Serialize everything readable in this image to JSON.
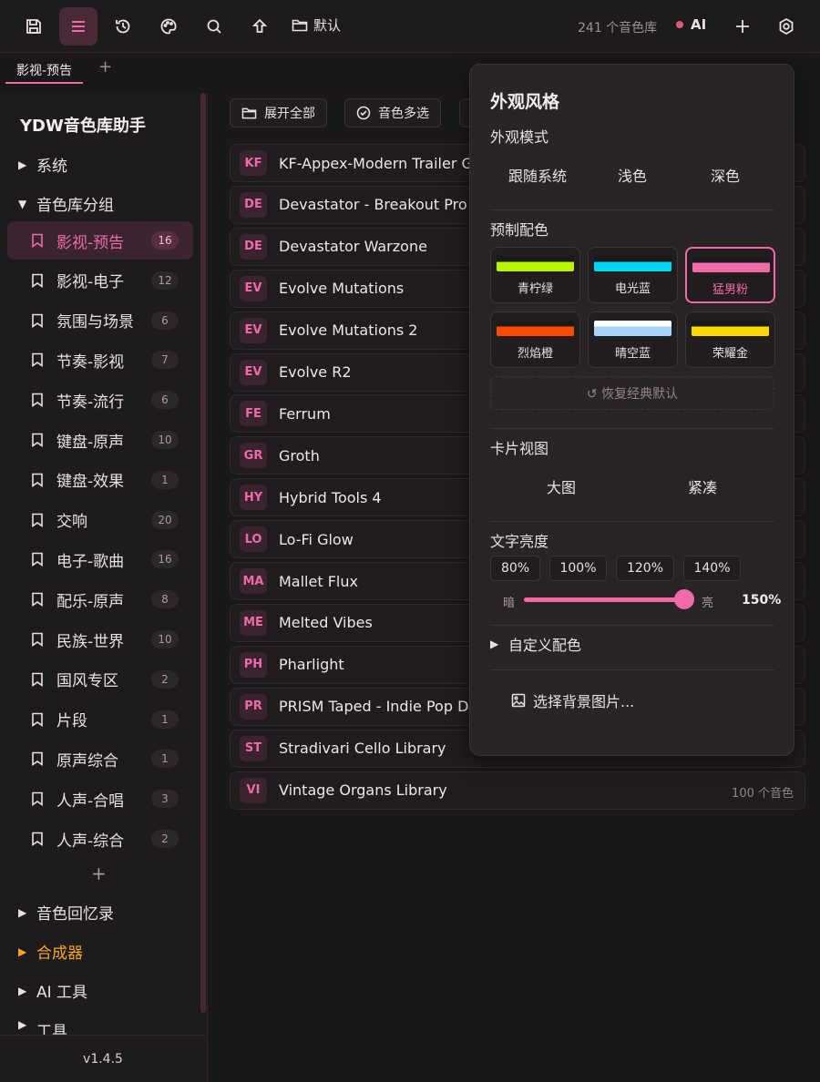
{
  "toolbar": {
    "folder_label": "默认",
    "library_count": "241 个音色库",
    "ai_label": "AI"
  },
  "tabs": {
    "active_tab": "影视-预告",
    "add_label": "+"
  },
  "sidebar": {
    "title": "YDW音色库助手",
    "sections": {
      "system": "系统",
      "groups": "音色库分组",
      "memory": "音色回忆录",
      "synth": "合成器",
      "ai_tools": "AI 工具",
      "tools": "工具"
    },
    "groups": [
      {
        "label": "影视-预告",
        "count": "16"
      },
      {
        "label": "影视-电子",
        "count": "12"
      },
      {
        "label": "氛围与场景",
        "count": "6"
      },
      {
        "label": "节奏-影视",
        "count": "7"
      },
      {
        "label": "节奏-流行",
        "count": "6"
      },
      {
        "label": "键盘-原声",
        "count": "10"
      },
      {
        "label": "键盘-效果",
        "count": "1"
      },
      {
        "label": "交响",
        "count": "20"
      },
      {
        "label": "电子-歌曲",
        "count": "16"
      },
      {
        "label": "配乐-原声",
        "count": "8"
      },
      {
        "label": "民族-世界",
        "count": "10"
      },
      {
        "label": "国风专区",
        "count": "2"
      },
      {
        "label": "片段",
        "count": "1"
      },
      {
        "label": "原声综合",
        "count": "1"
      },
      {
        "label": "人声-合唱",
        "count": "3"
      },
      {
        "label": "人声-综合",
        "count": "2"
      }
    ],
    "add_group": "+",
    "version": "v1.4.5"
  },
  "main": {
    "expand_all": "展开全部",
    "multi_select": "音色多选",
    "libraries": [
      {
        "badge": "KF",
        "name": "KF-Appex-Modern Trailer Gu",
        "count": ""
      },
      {
        "badge": "DE",
        "name": "Devastator - Breakout Pro",
        "count": ""
      },
      {
        "badge": "DE",
        "name": "Devastator Warzone",
        "count": ""
      },
      {
        "badge": "EV",
        "name": "Evolve Mutations",
        "count": ""
      },
      {
        "badge": "EV",
        "name": "Evolve Mutations 2",
        "count": ""
      },
      {
        "badge": "EV",
        "name": "Evolve R2",
        "count": ""
      },
      {
        "badge": "FE",
        "name": "Ferrum",
        "count": ""
      },
      {
        "badge": "GR",
        "name": "Groth",
        "count": ""
      },
      {
        "badge": "HY",
        "name": "Hybrid Tools 4",
        "count": ""
      },
      {
        "badge": "LO",
        "name": "Lo-Fi Glow",
        "count": ""
      },
      {
        "badge": "MA",
        "name": "Mallet Flux",
        "count": ""
      },
      {
        "badge": "ME",
        "name": "Melted Vibes",
        "count": ""
      },
      {
        "badge": "PH",
        "name": "Pharlight",
        "count": ""
      },
      {
        "badge": "PR",
        "name": "PRISM Taped - Indie Pop Dru",
        "count": ""
      },
      {
        "badge": "ST",
        "name": "Stradivari Cello Library",
        "count": ""
      },
      {
        "badge": "VI",
        "name": "Vintage Organs Library",
        "count": "100 个音色"
      }
    ]
  },
  "panel": {
    "title": "外观风格",
    "mode_label": "外观模式",
    "modes": [
      "跟随系统",
      "浅色",
      "深色"
    ],
    "preset_label": "预制配色",
    "presets": [
      {
        "name": "青柠绿",
        "color": "#b8f400",
        "top": "#1a1a1a"
      },
      {
        "name": "电光蓝",
        "color": "#00d4f0",
        "top": "#1a1a1a"
      },
      {
        "name": "猛男粉",
        "color": "#f06aa8",
        "top": "#1a1a1a"
      },
      {
        "name": "烈焰橙",
        "color": "#ff4a00",
        "top": "#1a1a1a"
      },
      {
        "name": "晴空蓝",
        "color": "#a8d4f8",
        "top": "#ffffff"
      },
      {
        "name": "荣耀金",
        "color": "#ffd700",
        "top": "#1a1a1a"
      }
    ],
    "selected_preset": "猛男粉",
    "restore_label": "↺ 恢复经典默认",
    "card_view_label": "卡片视图",
    "card_views": [
      "大图",
      "紧凑"
    ],
    "brightness_label": "文字亮度",
    "brightness_options": [
      "80%",
      "100%",
      "120%",
      "140%"
    ],
    "slider_dark": "暗",
    "slider_bright": "亮",
    "brightness_value": "150%",
    "brightness_level": 1.0,
    "custom_label": "自定义配色",
    "bg_label": "选择背景图片..."
  },
  "colors": {
    "accent": "#f06aa8",
    "background": "#1b1819",
    "panel": "#2a2426"
  },
  "icons": [
    "save-icon",
    "menu-icon",
    "history-icon",
    "palette-icon",
    "search-icon",
    "upload-icon",
    "folder-icon",
    "plus-icon",
    "settings-icon",
    "bookmark-icon",
    "check-circle-icon",
    "image-icon"
  ]
}
